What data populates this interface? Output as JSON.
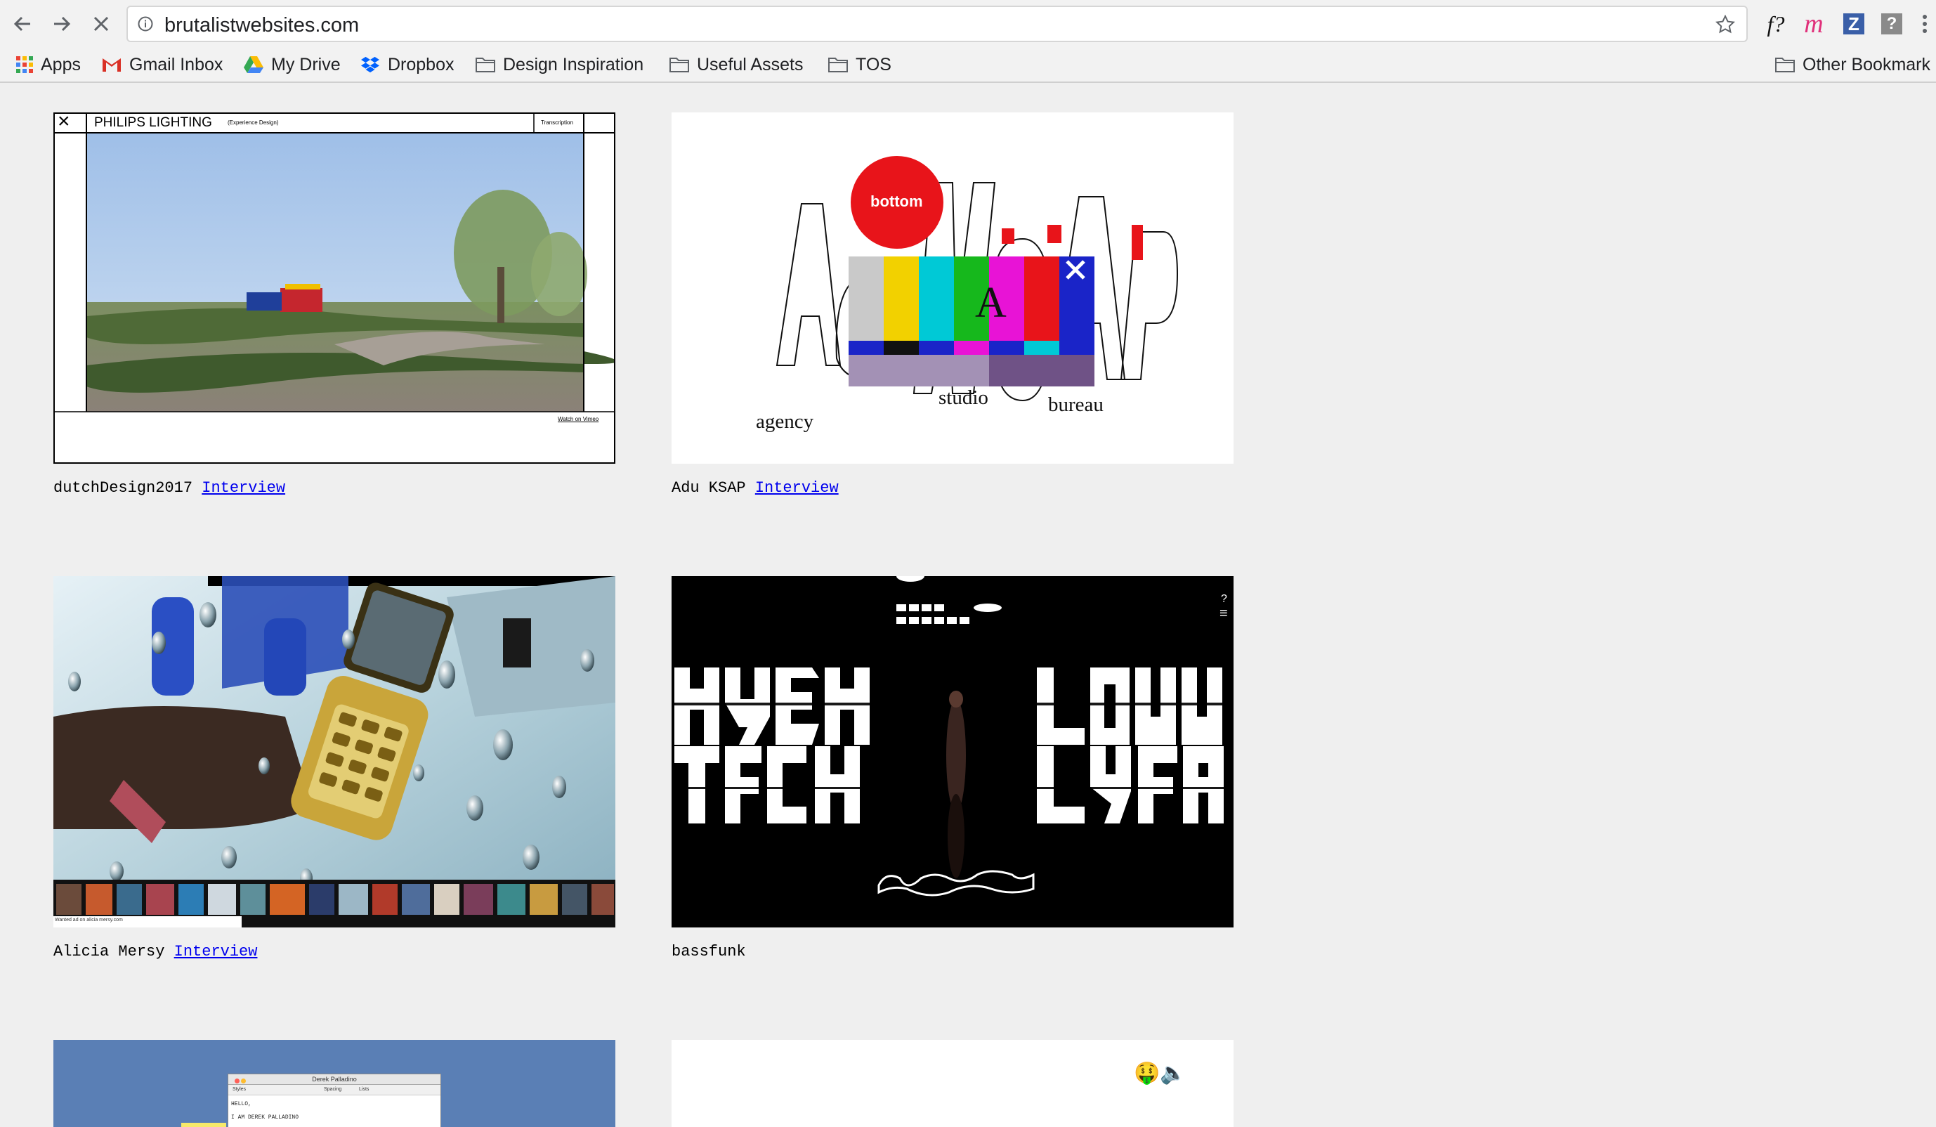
{
  "browser": {
    "url": "brutalistwebsites.com",
    "extensions": [
      "f?",
      "m",
      "Z",
      "?"
    ]
  },
  "bookmarks": {
    "items": [
      {
        "label": "Apps",
        "icon": "apps-grid-icon"
      },
      {
        "label": "Gmail Inbox",
        "icon": "gmail-icon"
      },
      {
        "label": "My Drive",
        "icon": "drive-icon"
      },
      {
        "label": "Dropbox",
        "icon": "dropbox-icon"
      },
      {
        "label": "Design Inspiration",
        "icon": "folder-icon"
      },
      {
        "label": "Useful Assets",
        "icon": "folder-icon"
      },
      {
        "label": "TOS",
        "icon": "folder-icon"
      }
    ],
    "other": "Other Bookmark"
  },
  "cards": [
    {
      "name": "dutchDesign2017",
      "link": "Interview",
      "inner": {
        "title": "PHILIPS LIGHTING",
        "subtitle": "(Experience Design)",
        "right": "Transcription",
        "footer": "Watch on Vimeo",
        "close": "×"
      }
    },
    {
      "name": "Adu KSAP",
      "link": "Interview",
      "inner": {
        "circle": "bottom",
        "letter": "A",
        "words": [
          "agency",
          "studio",
          "bureau"
        ],
        "close": "×"
      }
    },
    {
      "name": "Alicia Mersy",
      "link": "Interview",
      "inner": {
        "footer": "Wanted ad on alicia mersy.com"
      }
    },
    {
      "name": "bassfunk",
      "link": "",
      "inner": {
        "help": "?",
        "menu": "≡"
      }
    },
    {
      "inner": {
        "window_title": "Derek Palladino",
        "toolbar": [
          "Styles",
          "Spacing",
          "Lists"
        ],
        "text1": "HELLO,",
        "text2": "I AM DEREK PALLADINO"
      }
    },
    {
      "inner": {
        "emoji": "🤑🔈"
      }
    }
  ]
}
